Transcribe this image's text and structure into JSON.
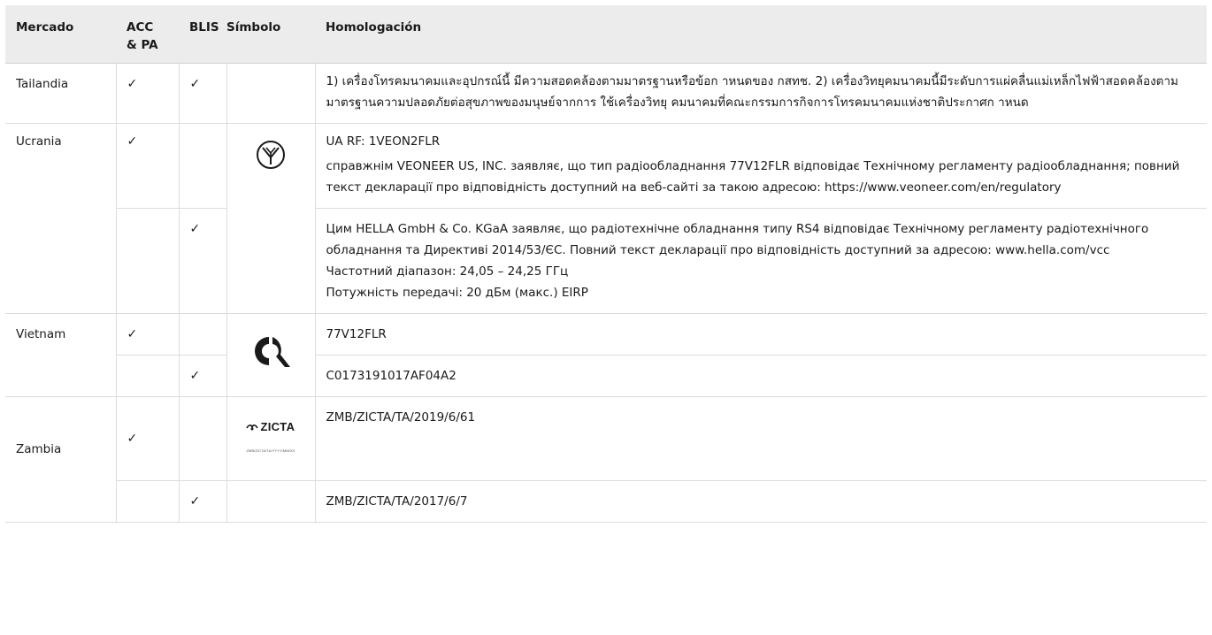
{
  "headers": {
    "market": "Mercado",
    "acc_pa_line1": "ACC",
    "acc_pa_line2": "& PA",
    "blis": "BLIS",
    "symbol": "Símbolo",
    "homologation": "Homologación"
  },
  "check_mark": "✓",
  "rows": {
    "thailand": {
      "market": "Tailandia",
      "homologation": "1) เครื่องโทรคมนาคมและอุปกรณ์นี้ มีความสอดคล้องตามมาตรฐานหรือข้อก าหนดของ กสทช. 2) เครื่องวิทยุคมนาคมนี้มีระดับการแผ่คลื่นแม่เหล็กไฟฟ้าสอดคล้องตาม มาตรฐานความปลอดภัยต่อสุขภาพของมนุษย์จากการ ใช้เครื่องวิทยุ คมนาคมที่คณะกรรมการกิจการโทรคมนาคมแห่งชาติประกาศก าหนด"
    },
    "ukraine": {
      "market": "Ucrania",
      "symbol_icon": "ukrainian-conformity-mark-icon",
      "acc_lines": [
        "UA RF: 1VEON2FLR",
        "справжнім VEONEER US, INC. заявляє, що тип радіообладнання 77V12FLR відповідає Технічному регламенту радіообладнання; повний текст декларації про відповідність доступний на веб-сайті за такою адресою: https://www.veoneer.com/en/regulatory"
      ],
      "blis_lines": [
        "Цим HELLA GmbH & Co. KGaA заявляє, що радіотехнічне обладнання типу RS4 відповідає Технічному регламенту радіотехнічного обладнання та Директиві 2014/53/ЄС. Повний текст декларації про відповідність доступний за адресою: www.hella.com/vcc",
        "Частотний діапазон: 24,05 – 24,25 ГГц",
        "Потужність передачі: 20 дБм (макс.) EIRP"
      ]
    },
    "vietnam": {
      "market": "Vietnam",
      "symbol_icon": "vietnam-cr-mark-icon",
      "acc_homologation": "77V12FLR",
      "blis_homologation": "C0173191017AF04A2"
    },
    "zambia": {
      "market": "Zambia",
      "symbol_main": "ZICTA",
      "symbol_sub": "ZMB/ZICTA/TA/YYYY/MM/XX",
      "acc_homologation": "ZMB/ZICTA/TA/2019/6/61",
      "blis_homologation": "ZMB/ZICTA/TA/2017/6/7"
    }
  }
}
